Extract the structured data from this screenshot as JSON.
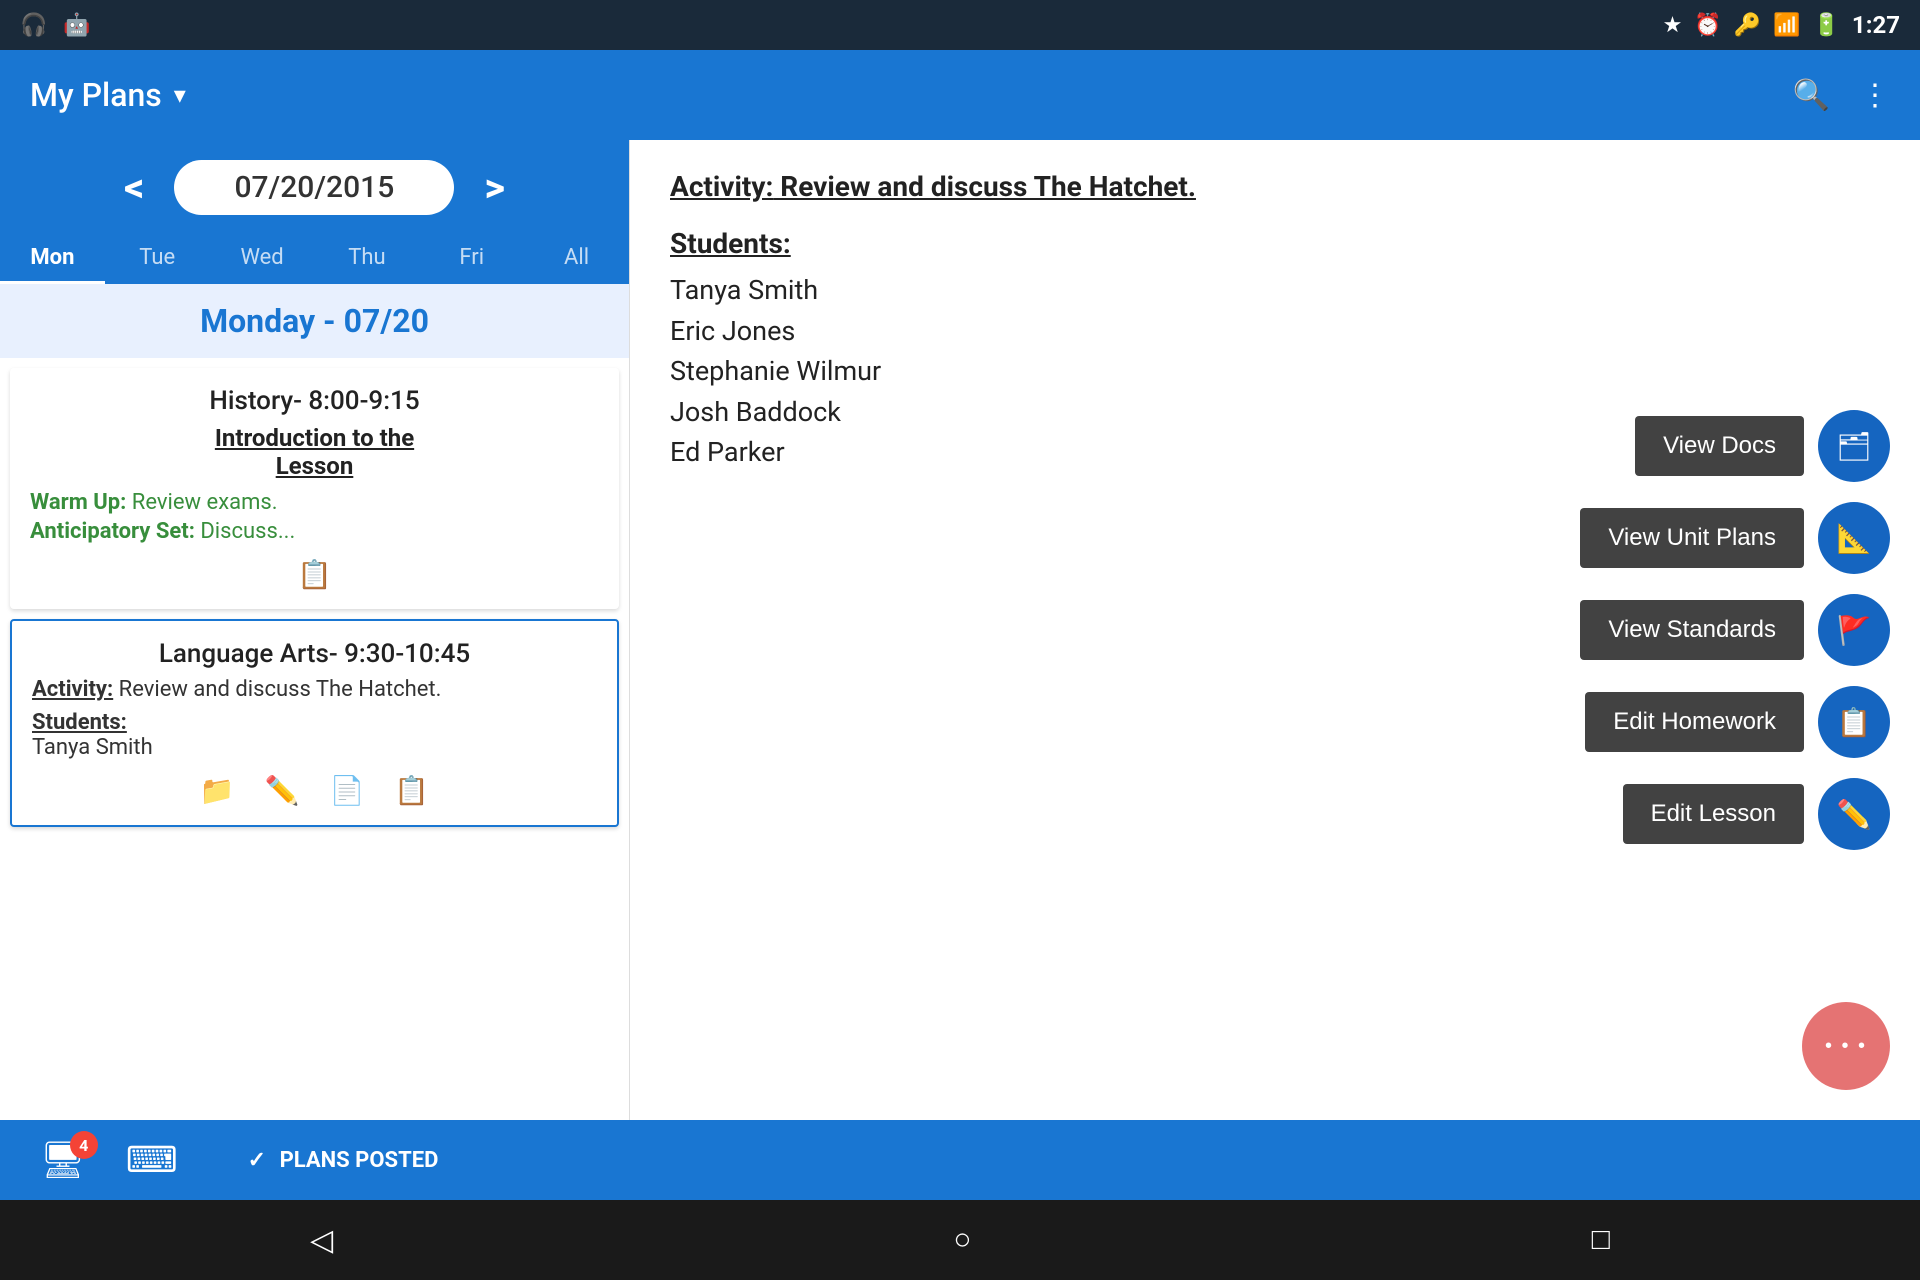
{
  "statusBar": {
    "time": "1:27",
    "icons": [
      "headset",
      "android",
      "star",
      "alarm",
      "key",
      "wifi",
      "battery"
    ]
  },
  "appBar": {
    "title": "My Plans",
    "dropdownLabel": "▾",
    "searchIcon": "🔍",
    "moreIcon": "⋮"
  },
  "dateNav": {
    "prevArrow": "<",
    "nextArrow": ">",
    "currentDate": "07/20/2015",
    "days": [
      {
        "label": "Mon",
        "active": true
      },
      {
        "label": "Tue",
        "active": false
      },
      {
        "label": "Wed",
        "active": false
      },
      {
        "label": "Thu",
        "active": false
      },
      {
        "label": "Fri",
        "active": false
      },
      {
        "label": "All",
        "active": false
      }
    ]
  },
  "dayHeader": "Monday - 07/20",
  "lessons": [
    {
      "time": "History- 8:00-9:15",
      "title": "Introduction to the Lesson",
      "warmupLabel": "Warm Up:",
      "warmupText": "  Review exams.",
      "anticipatoryLabel": "Anticipatory Set:",
      "anticipatoryText": "  Discuss...",
      "selected": false
    },
    {
      "time": "Language Arts- 9:30-10:45",
      "activityLabel": "Activity:",
      "activityText": " Review and discuss The Hatchet.",
      "studentsLabel": "Students:",
      "students": [
        "Tanya Smith"
      ],
      "selected": true
    }
  ],
  "detail": {
    "activityLabel": "Activity:",
    "activityText": " Review and discuss The Hatchet.",
    "studentsLabel": "Students:",
    "students": [
      "Tanya Smith",
      "Eric Jones",
      "Stephanie Wilmur",
      "Josh Baddock",
      "Ed Parker"
    ]
  },
  "actions": [
    {
      "label": "View Docs",
      "icon": "🗂",
      "name": "view-docs-button"
    },
    {
      "label": "View Unit Plans",
      "icon": "✏",
      "name": "view-unit-plans-button"
    },
    {
      "label": "View Standards",
      "icon": "🚩",
      "name": "view-standards-button"
    },
    {
      "label": "Edit Homework",
      "icon": "📋",
      "name": "edit-homework-button"
    },
    {
      "label": "Edit Lesson",
      "icon": "✎",
      "name": "edit-lesson-button"
    }
  ],
  "fab": {
    "icon": "•••",
    "label": "More options FAB"
  },
  "bottomBar": {
    "screenIcon": "🖥",
    "badge": "4",
    "keyboardIcon": "⌨",
    "plansPosted": "PLANS POSTED"
  },
  "androidNav": {
    "backIcon": "◁",
    "homeIcon": "○",
    "recentIcon": "□"
  }
}
